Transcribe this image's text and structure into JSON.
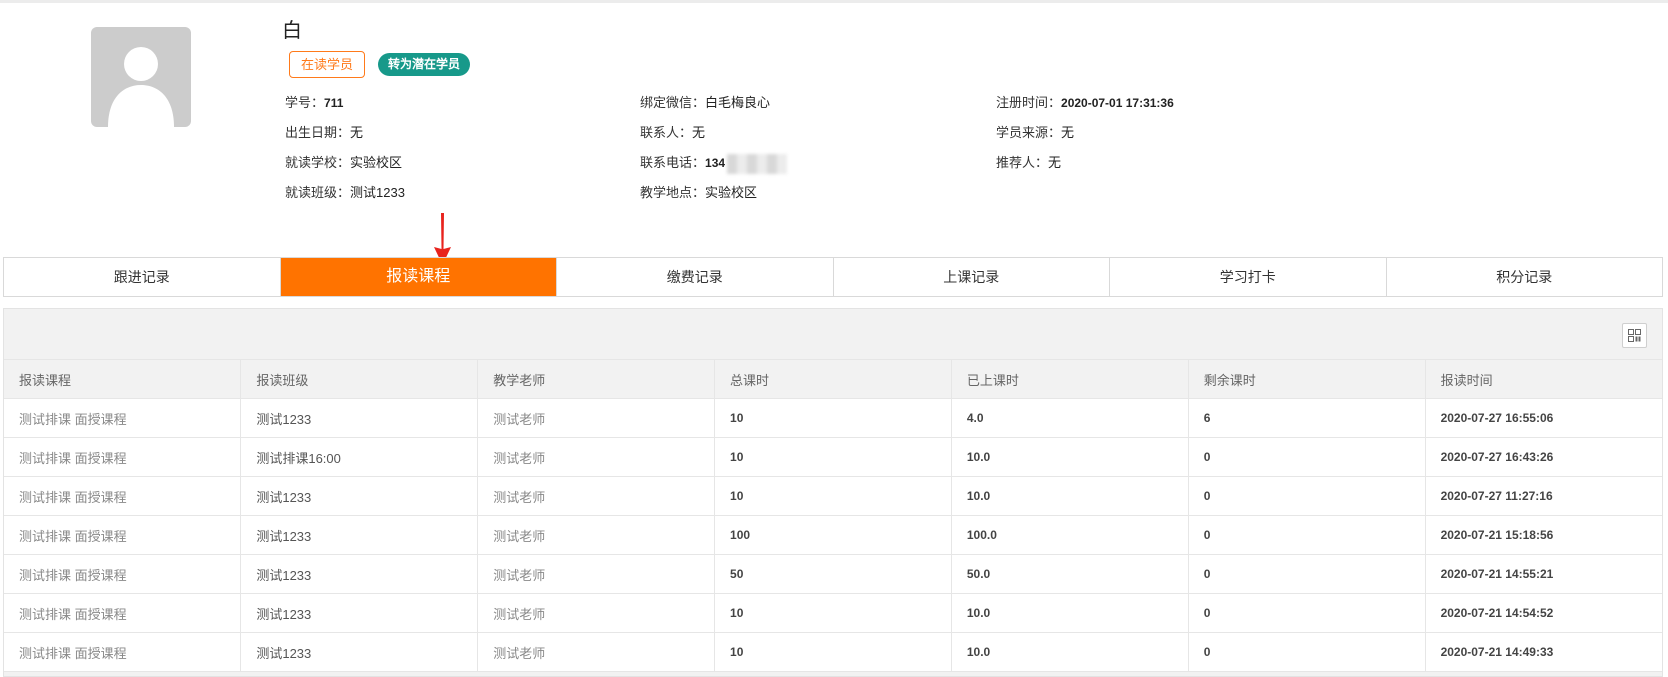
{
  "profile": {
    "name": "白",
    "status_badge": "在读学员",
    "convert_button": "转为潜在学员",
    "fields": {
      "student_no": {
        "label": "学号：",
        "value": "711"
      },
      "birth_date": {
        "label": "出生日期：",
        "value": "无"
      },
      "school": {
        "label": "就读学校：",
        "value": "实验校区"
      },
      "class": {
        "label": "就读班级：",
        "value": "测试1233"
      },
      "wechat": {
        "label": "绑定微信：",
        "value": "白毛梅良心"
      },
      "contact": {
        "label": "联系人：",
        "value": "无"
      },
      "phone": {
        "label": "联系电话：",
        "value": "134"
      },
      "location": {
        "label": "教学地点：",
        "value": "实验校区"
      },
      "register_time": {
        "label": "注册时间：",
        "value": "2020-07-01 17:31:36"
      },
      "source": {
        "label": "学员来源：",
        "value": "无"
      },
      "referrer": {
        "label": "推荐人：",
        "value": "无"
      }
    }
  },
  "tabs": [
    {
      "label": "跟进记录",
      "active": false
    },
    {
      "label": "报读课程",
      "active": true
    },
    {
      "label": "缴费记录",
      "active": false
    },
    {
      "label": "上课记录",
      "active": false
    },
    {
      "label": "学习打卡",
      "active": false
    },
    {
      "label": "积分记录",
      "active": false
    }
  ],
  "table": {
    "headers": [
      "报读课程",
      "报读班级",
      "教学老师",
      "总课时",
      "已上课时",
      "剩余课时",
      "报读时间"
    ],
    "rows": [
      [
        "测试排课 面授课程",
        "测试1233",
        "测试老师",
        "10",
        "4.0",
        "6",
        "2020-07-27 16:55:06"
      ],
      [
        "测试排课 面授课程",
        "测试排课16:00",
        "测试老师",
        "10",
        "10.0",
        "0",
        "2020-07-27 16:43:26"
      ],
      [
        "测试排课 面授课程",
        "测试1233",
        "测试老师",
        "10",
        "10.0",
        "0",
        "2020-07-27 11:27:16"
      ],
      [
        "测试排课 面授课程",
        "测试1233",
        "测试老师",
        "100",
        "100.0",
        "0",
        "2020-07-21 15:18:56"
      ],
      [
        "测试排课 面授课程",
        "测试1233",
        "测试老师",
        "50",
        "50.0",
        "0",
        "2020-07-21 14:55:21"
      ],
      [
        "测试排课 面授课程",
        "测试1233",
        "测试老师",
        "10",
        "10.0",
        "0",
        "2020-07-21 14:54:52"
      ],
      [
        "测试排课 面授课程",
        "测试1233",
        "测试老师",
        "10",
        "10.0",
        "0",
        "2020-07-21 14:49:33"
      ]
    ]
  },
  "icons": {
    "avatar": "user-placeholder-icon",
    "columns": "column-settings-icon",
    "annotation": "red-arrow-icon"
  },
  "colors": {
    "accent": "#ff7300",
    "badge_teal": "#17998a",
    "annotation_red": "#e8231d"
  }
}
